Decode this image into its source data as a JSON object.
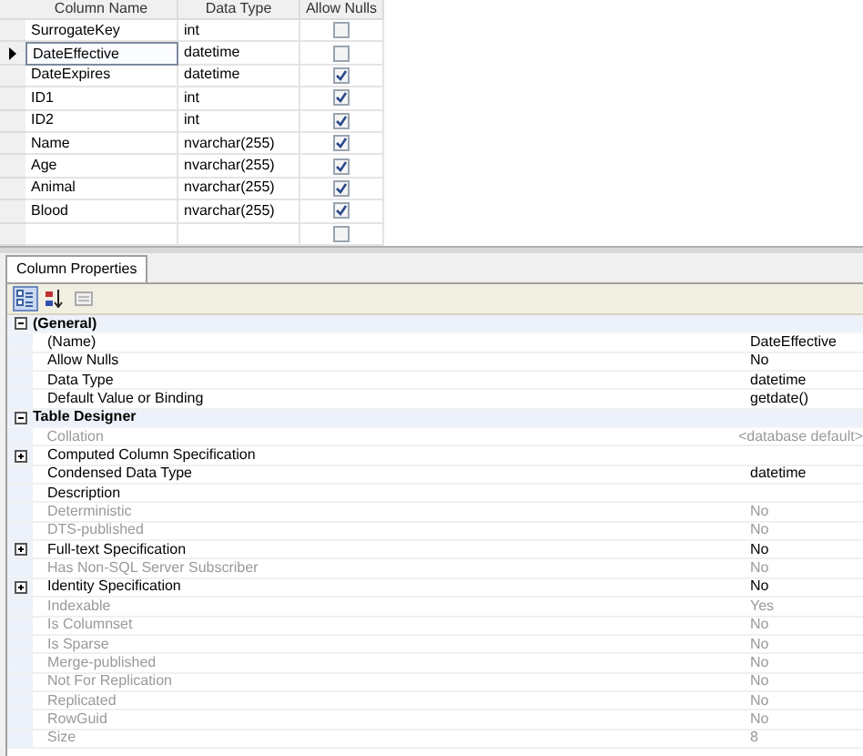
{
  "grid": {
    "columns": [
      "Column Name",
      "Data Type",
      "Allow Nulls"
    ],
    "rows": [
      {
        "name": "SurrogateKey",
        "type": "int",
        "allow_nulls": false,
        "selected": false
      },
      {
        "name": "DateEffective",
        "type": "datetime",
        "allow_nulls": false,
        "selected": true
      },
      {
        "name": "DateExpires",
        "type": "datetime",
        "allow_nulls": true,
        "selected": false
      },
      {
        "name": "ID1",
        "type": "int",
        "allow_nulls": true,
        "selected": false
      },
      {
        "name": "ID2",
        "type": "int",
        "allow_nulls": true,
        "selected": false
      },
      {
        "name": "Name",
        "type": "nvarchar(255)",
        "allow_nulls": true,
        "selected": false
      },
      {
        "name": "Age",
        "type": "nvarchar(255)",
        "allow_nulls": true,
        "selected": false
      },
      {
        "name": "Animal",
        "type": "nvarchar(255)",
        "allow_nulls": true,
        "selected": false
      },
      {
        "name": "Blood",
        "type": "nvarchar(255)",
        "allow_nulls": true,
        "selected": false
      },
      {
        "allow_nulls": false,
        "selected": false
      }
    ]
  },
  "tabs": [
    {
      "label": "Column Properties",
      "selected": true
    }
  ],
  "toolbar": [
    {
      "kind": "categorized",
      "selected": true
    },
    {
      "kind": "alphabetical",
      "selected": false
    },
    {
      "kind": "pages",
      "selected": false
    }
  ],
  "properties": [
    {
      "kind": "category",
      "label": "(General)",
      "expanded": true
    },
    {
      "kind": "property",
      "label": "(Name)",
      "value": "DateEffective",
      "disabled": false
    },
    {
      "kind": "property",
      "label": "Allow Nulls",
      "value": "No",
      "disabled": false
    },
    {
      "kind": "property",
      "label": "Data Type",
      "value": "datetime",
      "disabled": false
    },
    {
      "kind": "property",
      "label": "Default Value or Binding",
      "value": "getdate()",
      "disabled": false
    },
    {
      "kind": "category",
      "label": "Table Designer",
      "expanded": true
    },
    {
      "kind": "property",
      "label": "Collation",
      "value": "<database default>",
      "disabled": true
    },
    {
      "kind": "group",
      "label": "Computed Column Specification",
      "expanded": false,
      "disabled": false
    },
    {
      "kind": "property",
      "label": "Condensed Data Type",
      "value": "datetime",
      "disabled": false
    },
    {
      "kind": "property",
      "label": "Description",
      "disabled": false
    },
    {
      "kind": "property",
      "label": "Deterministic",
      "value": "No",
      "disabled": true
    },
    {
      "kind": "property",
      "label": "DTS-published",
      "value": "No",
      "disabled": true
    },
    {
      "kind": "group",
      "label": "Full-text Specification",
      "value": "No",
      "expanded": false,
      "disabled": false
    },
    {
      "kind": "property",
      "label": "Has Non-SQL Server Subscriber",
      "value": "No",
      "disabled": true
    },
    {
      "kind": "group",
      "label": "Identity Specification",
      "value": "No",
      "expanded": false,
      "disabled": false
    },
    {
      "kind": "property",
      "label": "Indexable",
      "value": "Yes",
      "disabled": true
    },
    {
      "kind": "property",
      "label": "Is Columnset",
      "value": "No",
      "disabled": true
    },
    {
      "kind": "property",
      "label": "Is Sparse",
      "value": "No",
      "disabled": true
    },
    {
      "kind": "property",
      "label": "Merge-published",
      "value": "No",
      "disabled": true
    },
    {
      "kind": "property",
      "label": "Not For Replication",
      "value": "No",
      "disabled": true
    },
    {
      "kind": "property",
      "label": "Replicated",
      "value": "No",
      "disabled": true
    },
    {
      "kind": "property",
      "label": "RowGuid",
      "value": "No",
      "disabled": true
    },
    {
      "kind": "property",
      "label": "Size",
      "value": "8",
      "disabled": true
    }
  ]
}
